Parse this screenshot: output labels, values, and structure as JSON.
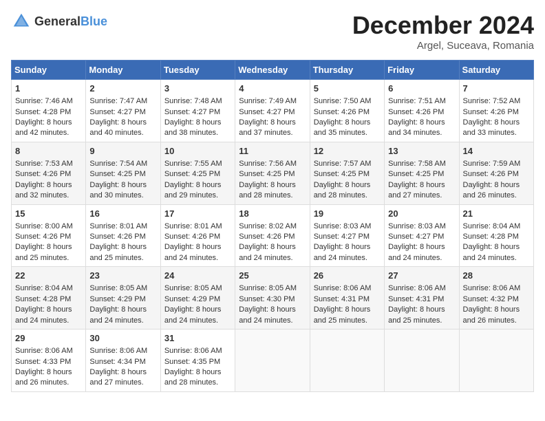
{
  "logo": {
    "general": "General",
    "blue": "Blue"
  },
  "title": "December 2024",
  "subtitle": "Argel, Suceava, Romania",
  "days_header": [
    "Sunday",
    "Monday",
    "Tuesday",
    "Wednesday",
    "Thursday",
    "Friday",
    "Saturday"
  ],
  "weeks": [
    [
      {
        "day": "1",
        "sunrise": "Sunrise: 7:46 AM",
        "sunset": "Sunset: 4:28 PM",
        "daylight": "Daylight: 8 hours and 42 minutes."
      },
      {
        "day": "2",
        "sunrise": "Sunrise: 7:47 AM",
        "sunset": "Sunset: 4:27 PM",
        "daylight": "Daylight: 8 hours and 40 minutes."
      },
      {
        "day": "3",
        "sunrise": "Sunrise: 7:48 AM",
        "sunset": "Sunset: 4:27 PM",
        "daylight": "Daylight: 8 hours and 38 minutes."
      },
      {
        "day": "4",
        "sunrise": "Sunrise: 7:49 AM",
        "sunset": "Sunset: 4:27 PM",
        "daylight": "Daylight: 8 hours and 37 minutes."
      },
      {
        "day": "5",
        "sunrise": "Sunrise: 7:50 AM",
        "sunset": "Sunset: 4:26 PM",
        "daylight": "Daylight: 8 hours and 35 minutes."
      },
      {
        "day": "6",
        "sunrise": "Sunrise: 7:51 AM",
        "sunset": "Sunset: 4:26 PM",
        "daylight": "Daylight: 8 hours and 34 minutes."
      },
      {
        "day": "7",
        "sunrise": "Sunrise: 7:52 AM",
        "sunset": "Sunset: 4:26 PM",
        "daylight": "Daylight: 8 hours and 33 minutes."
      }
    ],
    [
      {
        "day": "8",
        "sunrise": "Sunrise: 7:53 AM",
        "sunset": "Sunset: 4:26 PM",
        "daylight": "Daylight: 8 hours and 32 minutes."
      },
      {
        "day": "9",
        "sunrise": "Sunrise: 7:54 AM",
        "sunset": "Sunset: 4:25 PM",
        "daylight": "Daylight: 8 hours and 30 minutes."
      },
      {
        "day": "10",
        "sunrise": "Sunrise: 7:55 AM",
        "sunset": "Sunset: 4:25 PM",
        "daylight": "Daylight: 8 hours and 29 minutes."
      },
      {
        "day": "11",
        "sunrise": "Sunrise: 7:56 AM",
        "sunset": "Sunset: 4:25 PM",
        "daylight": "Daylight: 8 hours and 28 minutes."
      },
      {
        "day": "12",
        "sunrise": "Sunrise: 7:57 AM",
        "sunset": "Sunset: 4:25 PM",
        "daylight": "Daylight: 8 hours and 28 minutes."
      },
      {
        "day": "13",
        "sunrise": "Sunrise: 7:58 AM",
        "sunset": "Sunset: 4:25 PM",
        "daylight": "Daylight: 8 hours and 27 minutes."
      },
      {
        "day": "14",
        "sunrise": "Sunrise: 7:59 AM",
        "sunset": "Sunset: 4:26 PM",
        "daylight": "Daylight: 8 hours and 26 minutes."
      }
    ],
    [
      {
        "day": "15",
        "sunrise": "Sunrise: 8:00 AM",
        "sunset": "Sunset: 4:26 PM",
        "daylight": "Daylight: 8 hours and 25 minutes."
      },
      {
        "day": "16",
        "sunrise": "Sunrise: 8:01 AM",
        "sunset": "Sunset: 4:26 PM",
        "daylight": "Daylight: 8 hours and 25 minutes."
      },
      {
        "day": "17",
        "sunrise": "Sunrise: 8:01 AM",
        "sunset": "Sunset: 4:26 PM",
        "daylight": "Daylight: 8 hours and 24 minutes."
      },
      {
        "day": "18",
        "sunrise": "Sunrise: 8:02 AM",
        "sunset": "Sunset: 4:26 PM",
        "daylight": "Daylight: 8 hours and 24 minutes."
      },
      {
        "day": "19",
        "sunrise": "Sunrise: 8:03 AM",
        "sunset": "Sunset: 4:27 PM",
        "daylight": "Daylight: 8 hours and 24 minutes."
      },
      {
        "day": "20",
        "sunrise": "Sunrise: 8:03 AM",
        "sunset": "Sunset: 4:27 PM",
        "daylight": "Daylight: 8 hours and 24 minutes."
      },
      {
        "day": "21",
        "sunrise": "Sunrise: 8:04 AM",
        "sunset": "Sunset: 4:28 PM",
        "daylight": "Daylight: 8 hours and 24 minutes."
      }
    ],
    [
      {
        "day": "22",
        "sunrise": "Sunrise: 8:04 AM",
        "sunset": "Sunset: 4:28 PM",
        "daylight": "Daylight: 8 hours and 24 minutes."
      },
      {
        "day": "23",
        "sunrise": "Sunrise: 8:05 AM",
        "sunset": "Sunset: 4:29 PM",
        "daylight": "Daylight: 8 hours and 24 minutes."
      },
      {
        "day": "24",
        "sunrise": "Sunrise: 8:05 AM",
        "sunset": "Sunset: 4:29 PM",
        "daylight": "Daylight: 8 hours and 24 minutes."
      },
      {
        "day": "25",
        "sunrise": "Sunrise: 8:05 AM",
        "sunset": "Sunset: 4:30 PM",
        "daylight": "Daylight: 8 hours and 24 minutes."
      },
      {
        "day": "26",
        "sunrise": "Sunrise: 8:06 AM",
        "sunset": "Sunset: 4:31 PM",
        "daylight": "Daylight: 8 hours and 25 minutes."
      },
      {
        "day": "27",
        "sunrise": "Sunrise: 8:06 AM",
        "sunset": "Sunset: 4:31 PM",
        "daylight": "Daylight: 8 hours and 25 minutes."
      },
      {
        "day": "28",
        "sunrise": "Sunrise: 8:06 AM",
        "sunset": "Sunset: 4:32 PM",
        "daylight": "Daylight: 8 hours and 26 minutes."
      }
    ],
    [
      {
        "day": "29",
        "sunrise": "Sunrise: 8:06 AM",
        "sunset": "Sunset: 4:33 PM",
        "daylight": "Daylight: 8 hours and 26 minutes."
      },
      {
        "day": "30",
        "sunrise": "Sunrise: 8:06 AM",
        "sunset": "Sunset: 4:34 PM",
        "daylight": "Daylight: 8 hours and 27 minutes."
      },
      {
        "day": "31",
        "sunrise": "Sunrise: 8:06 AM",
        "sunset": "Sunset: 4:35 PM",
        "daylight": "Daylight: 8 hours and 28 minutes."
      },
      null,
      null,
      null,
      null
    ]
  ]
}
